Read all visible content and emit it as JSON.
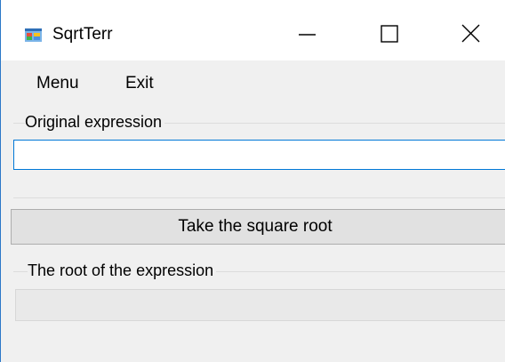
{
  "window": {
    "title": "SqrtTerr",
    "app_icon": "winforms-app-icon",
    "controls": {
      "minimize_icon": "minimize-icon",
      "maximize_icon": "maximize-icon",
      "close_icon": "close-icon"
    }
  },
  "menu": {
    "items": [
      {
        "label": "Menu"
      },
      {
        "label": "Exit"
      }
    ]
  },
  "original_group": {
    "legend": "Original expression",
    "input_value": ""
  },
  "action": {
    "label": "Take the square root"
  },
  "result_group": {
    "legend": "The root of the expression",
    "output_value": ""
  },
  "colors": {
    "focus_border": "#0078d7",
    "window_border": "#2b78c8",
    "button_face": "#e1e1e1",
    "disabled_field": "#e9e9e9"
  }
}
